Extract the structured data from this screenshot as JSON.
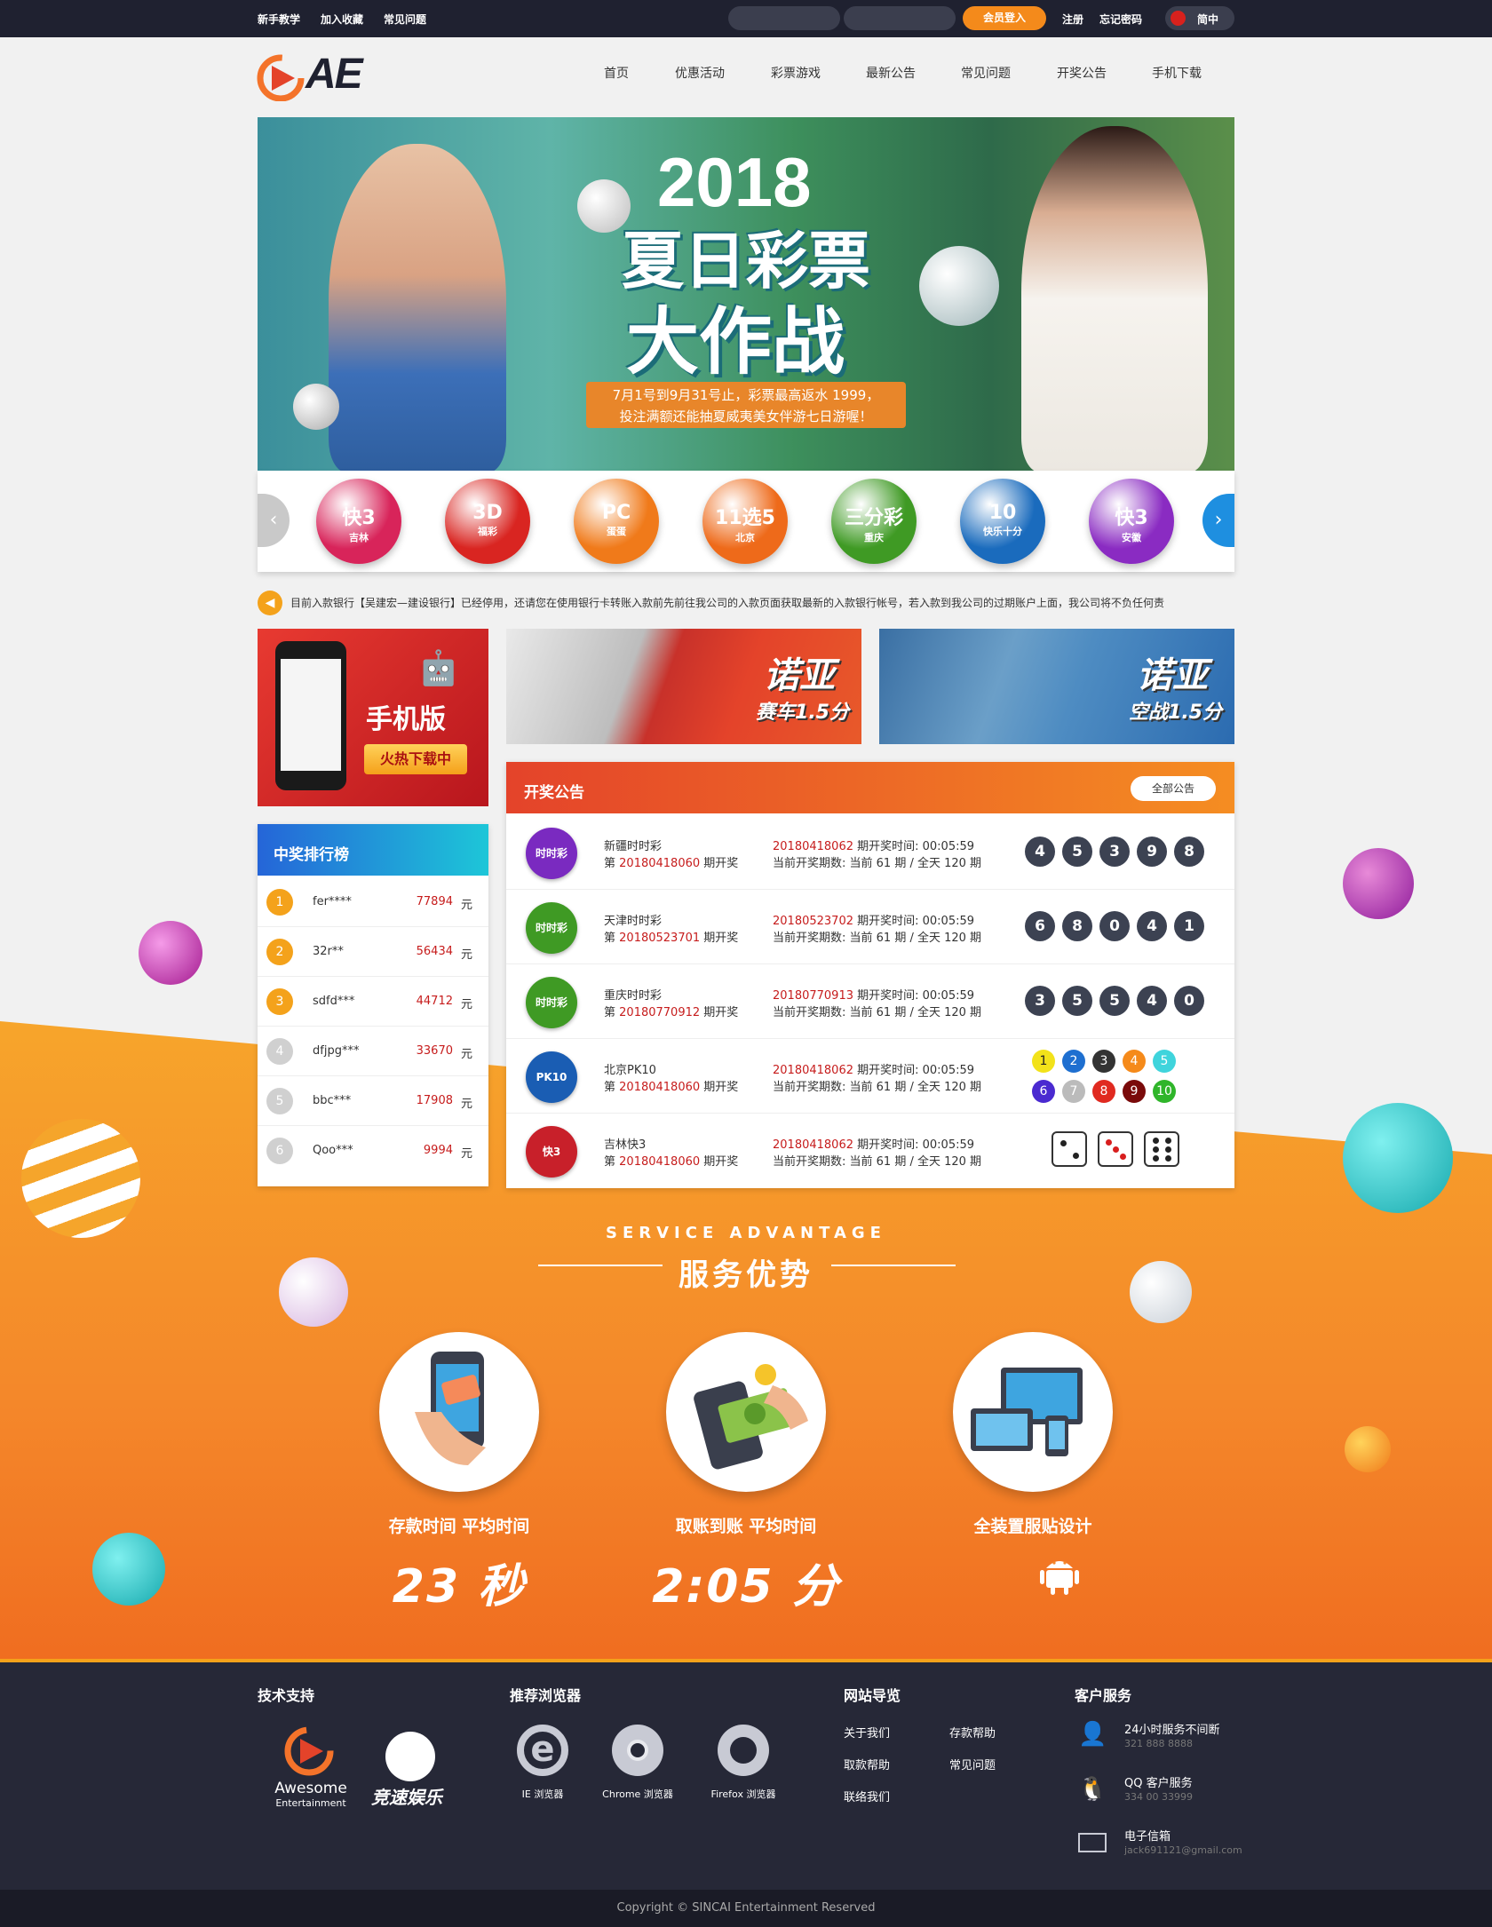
{
  "topbar": {
    "links": [
      "新手教学",
      "加入收藏",
      "常见问题"
    ],
    "login": "会员登入",
    "register": "注册",
    "forgot": "忘记密码",
    "lang": "简中"
  },
  "header": {
    "logo": "AE",
    "nav": [
      "首页",
      "优惠活动",
      "彩票游戏",
      "最新公告",
      "常见问题",
      "开奖公告",
      "手机下载"
    ]
  },
  "banner": {
    "year": "2018",
    "title1": "夏日彩票",
    "title2": "大作战",
    "ribbon_line1": "7月1号到9月31号止，彩票最高返水 1999，",
    "ribbon_line2": "投注满额还能抽夏威夷美女伴游七日游喔！"
  },
  "lotteries": [
    {
      "main": "快3",
      "sub": "吉林",
      "color": "#d8245a"
    },
    {
      "main": "3D",
      "sub": "福彩",
      "color": "#d92521"
    },
    {
      "main": "PC",
      "sub": "蛋蛋",
      "color": "#f07a1a"
    },
    {
      "main": "11选5",
      "sub": "北京",
      "color": "#ee6a1a"
    },
    {
      "main": "三分彩",
      "sub": "重庆",
      "color": "#3f9a24"
    },
    {
      "main": "10",
      "sub": "快乐十分",
      "color": "#1a6bbd"
    },
    {
      "main": "快3",
      "sub": "安徽",
      "color": "#8a2bc2"
    }
  ],
  "notice": "目前入款银行【吴建宏—建设银行】已经停用，还请您在使用银行卡转账入款前先前往我公司的入款页面获取最新的入款银行帐号，若入款到我公司的过期账户上面，我公司将不负任何责",
  "promos": {
    "mobile_label": "手机版",
    "mobile_btn": "火热下载中",
    "race_title": "诺亚",
    "race_sub": "赛车1.5分",
    "air_title": "诺亚",
    "air_sub": "空战1.5分"
  },
  "ranking": {
    "title": "中奖排行榜",
    "unit": "元",
    "rows": [
      {
        "rank": "1",
        "name": "fer****",
        "amount": "77894"
      },
      {
        "rank": "2",
        "name": "32r**",
        "amount": "56434"
      },
      {
        "rank": "3",
        "name": "sdfd***",
        "amount": "44712"
      },
      {
        "rank": "4",
        "name": "dfjpg***",
        "amount": "33670"
      },
      {
        "rank": "5",
        "name": "bbc***",
        "amount": "17908"
      },
      {
        "rank": "6",
        "name": "Qoo***",
        "amount": "9994"
      }
    ]
  },
  "draws": {
    "title": "开奖公告",
    "all_btn": "全部公告",
    "rows": [
      {
        "logo": "时时彩",
        "logo_color": "#7a2ac0",
        "name": "新疆时时彩",
        "issue_prefix": "第",
        "issue": "20180418060",
        "issue_suffix": "期开奖",
        "next_issue": "20180418062",
        "next_label": "期开奖时间: 00:05:59",
        "count": "当前开奖期数: 当前 61 期 / 全天 120 期",
        "balls": [
          "4",
          "5",
          "3",
          "9",
          "8"
        ]
      },
      {
        "logo": "时时彩",
        "logo_color": "#3f9a24",
        "name": "天津时时彩",
        "issue_prefix": "第",
        "issue": "20180523701",
        "issue_suffix": "期开奖",
        "next_issue": "20180523702",
        "next_label": "期开奖时间: 00:05:59",
        "count": "当前开奖期数: 当前 61 期 / 全天 120 期",
        "balls": [
          "6",
          "8",
          "0",
          "4",
          "1"
        ]
      },
      {
        "logo": "时时彩",
        "logo_color": "#3f9a24",
        "name": "重庆时时彩",
        "issue_prefix": "第",
        "issue": "20180770912",
        "issue_suffix": "期开奖",
        "next_issue": "20180770913",
        "next_label": "期开奖时间: 00:05:59",
        "count": "当前开奖期数: 当前 61 期 / 全天 120 期",
        "balls": [
          "3",
          "5",
          "5",
          "4",
          "0"
        ]
      },
      {
        "logo": "PK10",
        "logo_color": "#1a5db3",
        "name": "北京PK10",
        "issue_prefix": "第",
        "issue": "20180418060",
        "issue_suffix": "期开奖",
        "next_issue": "20180418062",
        "next_label": "期开奖时间: 00:05:59",
        "count": "当前开奖期数: 当前 61 期 / 全天 120 期",
        "pk": [
          "1",
          "2",
          "3",
          "4",
          "5",
          "6",
          "7",
          "8",
          "9",
          "10"
        ],
        "pk_colors": [
          "#f2e21a",
          "#1e6fd0",
          "#333333",
          "#f58a1a",
          "#3fd4dc",
          "#4a2ad0",
          "#bbbbbb",
          "#e02a20",
          "#7a0a0a",
          "#2fb52a"
        ]
      },
      {
        "logo": "快3",
        "logo_color": "#c8202a",
        "name": "吉林快3",
        "issue_prefix": "第",
        "issue": "20180418060",
        "issue_suffix": "期开奖",
        "next_issue": "20180418062",
        "next_label": "期开奖时间: 00:05:59",
        "count": "当前开奖期数: 当前 61 期 / 全天 120 期",
        "dice": [
          2,
          3,
          6
        ]
      }
    ]
  },
  "service": {
    "en": "SERVICE ADVANTAGE",
    "cn": "服务优势",
    "items": [
      {
        "label": "存款时间 平均时间",
        "value": "23 秒"
      },
      {
        "label": "取账到账 平均时间",
        "value": "2:05 分"
      },
      {
        "label": "全装置服贴设计",
        "value": ""
      }
    ]
  },
  "footer": {
    "tech_title": "技术支持",
    "tech_brand1": "Awesome",
    "tech_brand1_sub": "Entertainment",
    "tech_brand2": "竞速娱乐",
    "browser_title": "推荐浏览器",
    "browsers": [
      "IE 浏览器",
      "Chrome 浏览器",
      "Firefox 浏览器"
    ],
    "nav_title": "网站导览",
    "nav_links": [
      "关于我们",
      "存款帮助",
      "取款帮助",
      "常见问题",
      "联络我们"
    ],
    "cs_title": "客户服务",
    "cs": [
      {
        "label": "24小时服务不间断",
        "value": "321 888 8888"
      },
      {
        "label": "QQ 客户服务",
        "value": "334 00 33999"
      },
      {
        "label": "电子信箱",
        "value": "jack691121@gmail.com"
      }
    ],
    "copyright": "Copyright © SINCAI Entertainment Reserved"
  },
  "colors": {
    "accent": "#f48a1b",
    "dark": "#1f2130",
    "draw_red": "#c61c1c"
  }
}
